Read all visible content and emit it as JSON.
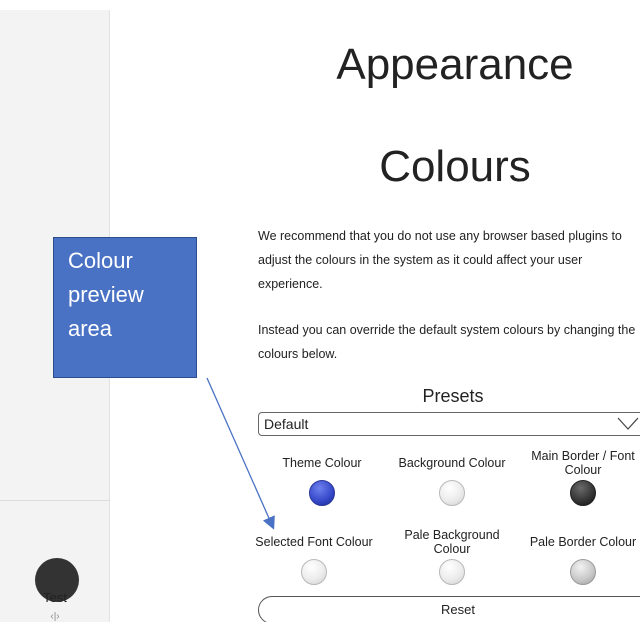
{
  "sidebar": {
    "user_name": "Test",
    "more_indicator": "‹|›"
  },
  "page": {
    "title": "Appearance",
    "section_title": "Colours",
    "description_1": [
      "We recommend that you do not use any browser based plugins to",
      "adjust the colours in the system as it could affect your user",
      "experience."
    ],
    "description_2": [
      "Instead you can override the default system colours by changing the",
      "colours below."
    ]
  },
  "presets": {
    "label": "Presets",
    "selected": "Default"
  },
  "swatches": [
    {
      "label": "Theme Colour",
      "color": "#3447c8"
    },
    {
      "label": "Background Colour",
      "color": "#ececec"
    },
    {
      "label": "Main Border / Font Colour",
      "color": "#333333"
    },
    {
      "label": "Selected Font Colour",
      "color": "#ececec"
    },
    {
      "label": "Pale Background Colour",
      "color": "#ececec"
    },
    {
      "label": "Pale Border Colour",
      "color": "#c6c6c6"
    }
  ],
  "reset_label": "Reset",
  "annotation": {
    "lines": [
      "Colour",
      "preview",
      "area"
    ],
    "box_color": "#4a72c4",
    "arrow_color": "#4a72c4"
  }
}
